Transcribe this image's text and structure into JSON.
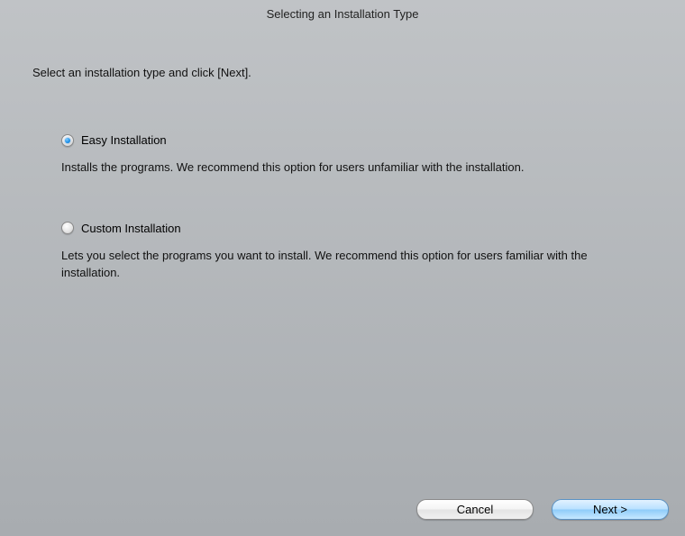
{
  "title": "Selecting an Installation Type",
  "instruction": "Select an installation type and click [Next].",
  "options": {
    "easy": {
      "label": "Easy Installation",
      "description": "Installs the programs. We recommend this option for users unfamiliar with the installation.",
      "selected": true
    },
    "custom": {
      "label": "Custom Installation",
      "description": "Lets you select the programs you want to install. We recommend this option for users familiar with the installation.",
      "selected": false
    }
  },
  "buttons": {
    "cancel": "Cancel",
    "next": "Next >"
  }
}
